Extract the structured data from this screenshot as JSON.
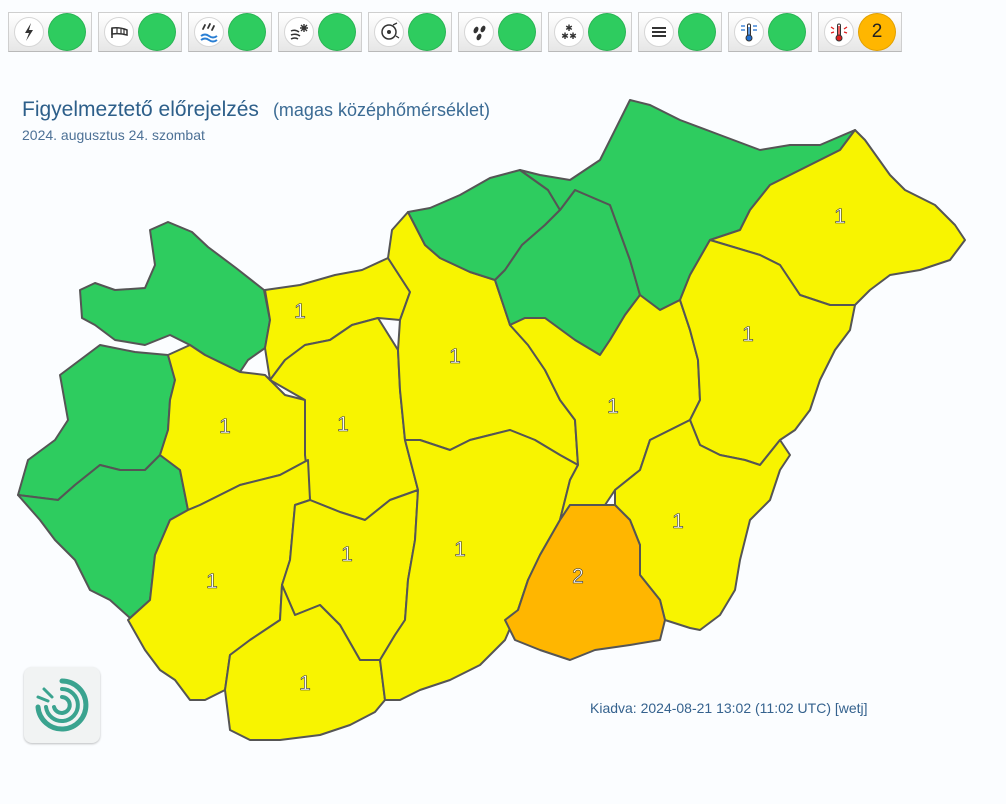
{
  "colors": {
    "green": "#2ecc5f",
    "yellow": "#f8f400",
    "orange": "#ffb600",
    "border": "#555555"
  },
  "toolbar": [
    {
      "icon": "lightning-icon",
      "level_color": "#2ecc5f",
      "level_text": ""
    },
    {
      "icon": "wind-icon",
      "level_color": "#2ecc5f",
      "level_text": ""
    },
    {
      "icon": "rain-icon",
      "level_color": "#2ecc5f",
      "level_text": ""
    },
    {
      "icon": "snow-drift-icon",
      "level_color": "#2ecc5f",
      "level_text": ""
    },
    {
      "icon": "freezing-rain-icon",
      "level_color": "#2ecc5f",
      "level_text": ""
    },
    {
      "icon": "heavy-rain-icon",
      "level_color": "#2ecc5f",
      "level_text": ""
    },
    {
      "icon": "snowfall-icon",
      "level_color": "#2ecc5f",
      "level_text": ""
    },
    {
      "icon": "fog-icon",
      "level_color": "#2ecc5f",
      "level_text": ""
    },
    {
      "icon": "cold-thermometer-icon",
      "level_color": "#2ecc5f",
      "level_text": ""
    },
    {
      "icon": "hot-thermometer-icon",
      "level_color": "#ffb600",
      "level_text": "2"
    }
  ],
  "header": {
    "title": "Figyelmeztető előrejelzés",
    "subtitle": "(magas középhőmérséklet)",
    "date": "2024. augusztus 24. szombat"
  },
  "regions": [
    {
      "id": "gyor-moson-sopron",
      "level": 0,
      "label": ""
    },
    {
      "id": "vas",
      "level": 0,
      "label": ""
    },
    {
      "id": "zala",
      "level": 0,
      "label": ""
    },
    {
      "id": "veszprem",
      "level": 1,
      "label": "1"
    },
    {
      "id": "komarom-esztergom",
      "level": 1,
      "label": "1"
    },
    {
      "id": "fejer",
      "level": 1,
      "label": "1"
    },
    {
      "id": "pest",
      "level": 1,
      "label": "1"
    },
    {
      "id": "somogy",
      "level": 1,
      "label": "1"
    },
    {
      "id": "tolna",
      "level": 1,
      "label": "1"
    },
    {
      "id": "baranya",
      "level": 1,
      "label": "1"
    },
    {
      "id": "bacs-kiskun",
      "level": 1,
      "label": "1"
    },
    {
      "id": "nograd",
      "level": 0,
      "label": ""
    },
    {
      "id": "heves",
      "level": 0,
      "label": ""
    },
    {
      "id": "borsod-abauj-zemplen",
      "level": 0,
      "label": ""
    },
    {
      "id": "jasz-nagykun-szolnok",
      "level": 1,
      "label": "1"
    },
    {
      "id": "szabolcs-szatmar-bereg",
      "level": 1,
      "label": "1"
    },
    {
      "id": "hajdu-bihar",
      "level": 1,
      "label": "1"
    },
    {
      "id": "bekes",
      "level": 1,
      "label": "1"
    },
    {
      "id": "csongrad-csanad",
      "level": 2,
      "label": "2"
    }
  ],
  "footer": {
    "issued": "Kiadva: 2024-08-21 13:02 (11:02 UTC) [wetj]"
  },
  "logo": {
    "icon": "met-service-swirl-logo"
  }
}
